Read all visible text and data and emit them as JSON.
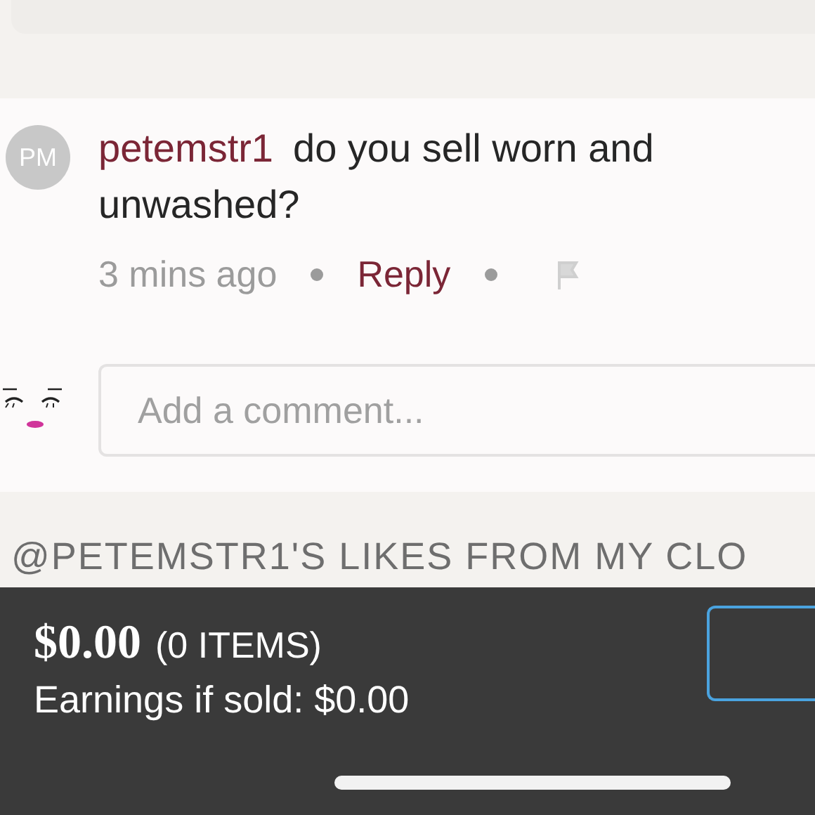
{
  "comment": {
    "avatar_initials": "PM",
    "username": "petemstr1",
    "text": "do you sell worn and unwashed?",
    "time": "3 mins ago",
    "reply": "Reply"
  },
  "comment_input": {
    "placeholder": "Add a comment..."
  },
  "section_title": "@PETEMSTR1'S LIKES FROM MY CLO",
  "bundle_bar": {
    "total": "$0.00",
    "items": "(0 ITEMS)",
    "earnings": "Earnings if sold: $0.00"
  }
}
